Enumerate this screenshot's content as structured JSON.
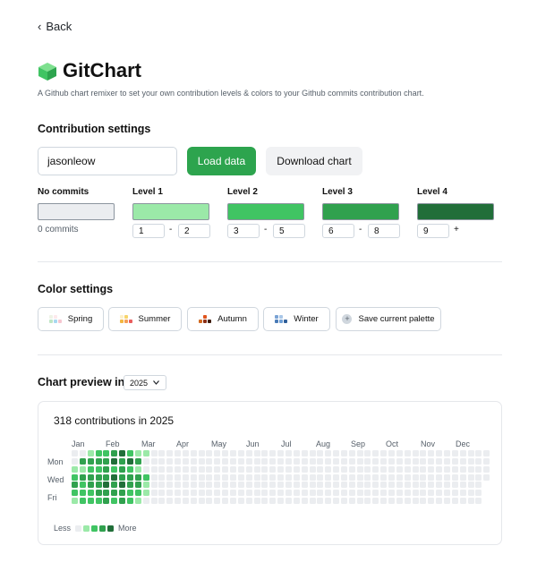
{
  "nav": {
    "back_label": "Back"
  },
  "app": {
    "title": "GitChart",
    "subtitle": "A Github chart remixer to set your own contribution levels & colors to your Github commits contribution chart."
  },
  "contribution_settings": {
    "heading": "Contribution settings",
    "username_value": "jasonleow",
    "load_label": "Load data",
    "download_label": "Download chart",
    "levels": [
      {
        "label": "No commits",
        "color": "#ebedf0",
        "text": "0 commits"
      },
      {
        "label": "Level 1",
        "color": "#9be9a8",
        "min": "1",
        "max": "2"
      },
      {
        "label": "Level 2",
        "color": "#40c463",
        "min": "3",
        "max": "5"
      },
      {
        "label": "Level 3",
        "color": "#30a14e",
        "min": "6",
        "max": "8"
      },
      {
        "label": "Level 4",
        "color": "#216e39",
        "min": "9",
        "suffix": "+"
      }
    ],
    "range_separator": "-"
  },
  "color_settings": {
    "heading": "Color settings",
    "palettes": [
      {
        "label": "Spring",
        "icon": "spring-palette-icon",
        "colors": [
          "#eef3e6",
          "#fde9ec",
          "#ffffff",
          "#bfe6c4",
          "#a8d8f0",
          "#f6c6d0"
        ]
      },
      {
        "label": "Summer",
        "icon": "summer-palette-icon",
        "colors": [
          "#fdf0c9",
          "#f7d46b",
          "#ffffff",
          "#f4b740",
          "#f59e54",
          "#e95d5d"
        ]
      },
      {
        "label": "Autumn",
        "icon": "autumn-palette-icon",
        "colors": [
          "#ffffff",
          "#e0541d",
          "#ffffff",
          "#d2691e",
          "#8b2e16",
          "#3d1a0a"
        ]
      },
      {
        "label": "Winter",
        "icon": "winter-palette-icon",
        "colors": [
          "#7aa3d4",
          "#a9c7e8",
          "#ffffff",
          "#4a7bb7",
          "#6e9fd6",
          "#2f5e99"
        ]
      }
    ],
    "save_label": "Save current palette"
  },
  "preview": {
    "heading": "Chart preview in",
    "year": "2025",
    "contrib_summary": "318 contributions in 2025",
    "months": [
      "Jan",
      "Feb",
      "Mar",
      "Apr",
      "May",
      "Jun",
      "Jul",
      "Aug",
      "Sep",
      "Oct",
      "Nov",
      "Dec"
    ],
    "day_labels": [
      "Mon",
      "Wed",
      "Fri"
    ],
    "legend_less": "Less",
    "legend_more": "More",
    "grid": {
      "active_columns": [
        [
          0,
          0,
          1,
          2,
          3,
          2,
          1
        ],
        [
          0,
          3,
          1,
          3,
          2,
          2,
          2
        ],
        [
          1,
          3,
          2,
          3,
          3,
          2,
          2
        ],
        [
          2,
          3,
          2,
          3,
          3,
          3,
          2
        ],
        [
          2,
          3,
          3,
          3,
          4,
          3,
          3
        ],
        [
          3,
          4,
          2,
          4,
          3,
          3,
          2
        ],
        [
          4,
          3,
          3,
          3,
          4,
          3,
          3
        ],
        [
          2,
          4,
          2,
          3,
          3,
          2,
          2
        ],
        [
          1,
          3,
          1,
          3,
          3,
          2,
          1
        ],
        [
          1,
          0,
          0,
          2,
          1,
          1,
          0
        ]
      ],
      "total_weeks": 53
    }
  }
}
